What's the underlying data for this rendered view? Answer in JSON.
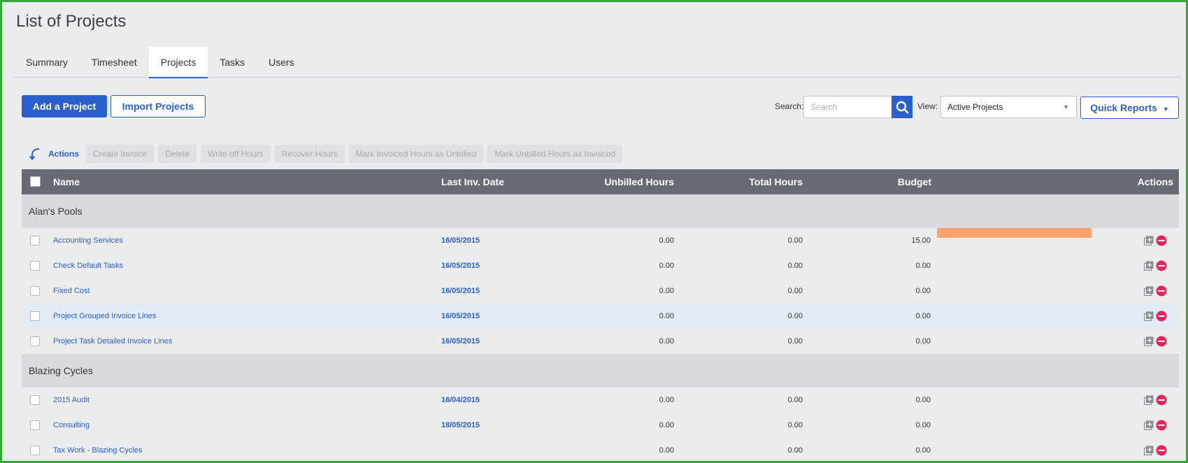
{
  "page": {
    "title": "List of Projects"
  },
  "tabs": [
    {
      "label": "Summary"
    },
    {
      "label": "Timesheet"
    },
    {
      "label": "Projects",
      "active": true
    },
    {
      "label": "Tasks"
    },
    {
      "label": "Users"
    }
  ],
  "toolbar": {
    "add_label": "Add a Project",
    "import_label": "Import Projects",
    "search_label": "Search:",
    "search_placeholder": "Search",
    "view_label": "View:",
    "view_value": "Active Projects",
    "quick_reports_label": "Quick Reports"
  },
  "bulk_actions": {
    "label": "Actions",
    "items": [
      "Create Invoice",
      "Delete",
      "Write off Hours",
      "Recover Hours",
      "Mark Invoiced Hours as Unbilled",
      "Mark Unbilled Hours as Invoiced"
    ]
  },
  "table": {
    "headers": {
      "name": "Name",
      "last_inv_date": "Last Inv. Date",
      "unbilled_hours": "Unbilled Hours",
      "total_hours": "Total Hours",
      "budget": "Budget",
      "actions": "Actions"
    },
    "groups": [
      {
        "client": "Alan's Pools",
        "rows": [
          {
            "name": "Accounting Services",
            "last_inv_date": "16/05/2015",
            "unbilled": "0.00",
            "total": "0.00",
            "budget": "15.00",
            "budget_used_fraction": 1.0
          },
          {
            "name": "Check Default Tasks",
            "last_inv_date": "16/05/2015",
            "unbilled": "0.00",
            "total": "0.00",
            "budget": "0.00"
          },
          {
            "name": "Fixed Cost",
            "last_inv_date": "16/05/2015",
            "unbilled": "0.00",
            "total": "0.00",
            "budget": "0.00"
          },
          {
            "name": "Project Grouped Invoice Lines",
            "last_inv_date": "16/05/2015",
            "unbilled": "0.00",
            "total": "0.00",
            "budget": "0.00",
            "highlighted": true
          },
          {
            "name": "Project Task Detailed Invoice Lines",
            "last_inv_date": "16/05/2015",
            "unbilled": "0.00",
            "total": "0.00",
            "budget": "0.00"
          }
        ]
      },
      {
        "client": "Blazing Cycles",
        "rows": [
          {
            "name": "2015 Audit",
            "last_inv_date": "16/04/2015",
            "unbilled": "0.00",
            "total": "0.00",
            "budget": "0.00"
          },
          {
            "name": "Consulting",
            "last_inv_date": "18/05/2015",
            "unbilled": "0.00",
            "total": "0.00",
            "budget": "0.00"
          },
          {
            "name": "Tax Work - Blazing Cycles",
            "last_inv_date": "",
            "unbilled": "0.00",
            "total": "0.00",
            "budget": "0.00"
          }
        ]
      }
    ]
  },
  "colors": {
    "accent": "#2a5fcf",
    "header_bg": "#666a73",
    "budget_bar": "#fba36f",
    "delete_icon": "#e8245c",
    "frame_border": "#3aa53a"
  },
  "icons": {
    "search": "search-icon",
    "copy": "copy-plus-icon",
    "delete": "remove-circle-icon",
    "actions_arrow": "arrow-down-left-icon"
  }
}
